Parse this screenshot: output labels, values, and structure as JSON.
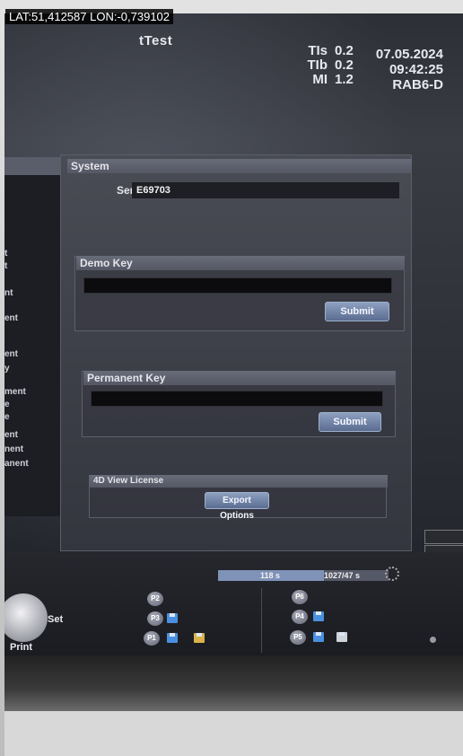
{
  "overlay": {
    "gps": "LAT:51,412587 LON:-0,739102"
  },
  "header": {
    "title": "tTest",
    "params": [
      {
        "key": "TIs",
        "value": "0.2"
      },
      {
        "key": "TIb",
        "value": "0.2"
      },
      {
        "key": "MI",
        "value": "1.2"
      }
    ],
    "date": "07.05.2024",
    "time": "09:42:25",
    "probe": "RAB6-D"
  },
  "left_panel": {
    "fragments": [
      "t",
      "t",
      "nt",
      "ent",
      "ent",
      "y",
      "ment",
      "e",
      "e",
      "ent",
      "nent",
      "anent"
    ]
  },
  "system": {
    "heading": "System",
    "serial_label": "Serial Number",
    "serial_value": "E69703"
  },
  "demo_key": {
    "heading": "Demo Key",
    "value": "",
    "submit": "Submit"
  },
  "permanent_key": {
    "heading": "Permanent Key",
    "value": "",
    "submit": "Submit"
  },
  "view_license": {
    "heading": "4D View License",
    "button": "Export Options"
  },
  "bottom": {
    "progress_text_1": "118 s",
    "progress_text_2": "1027/47 s",
    "progress_fraction": 0.62,
    "trackball_label": "Set",
    "print_label": "Print",
    "fkeys_left": [
      "P2",
      "P3",
      "P1"
    ],
    "fkeys_right": [
      "P6",
      "P4",
      "P5"
    ]
  },
  "colors": {
    "accent_button": "#6a7ca0",
    "floppy": "#4a90e0"
  }
}
